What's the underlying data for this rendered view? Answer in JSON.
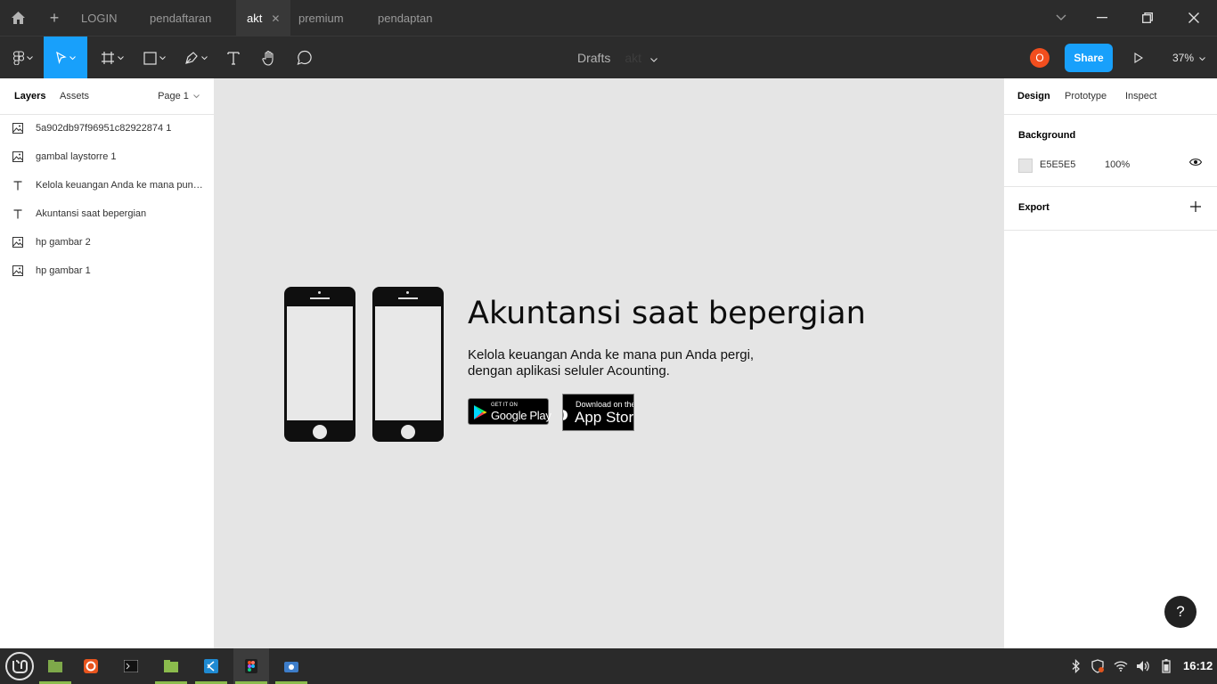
{
  "tabbar": {
    "tabs": [
      {
        "label": "LOGIN",
        "active": false
      },
      {
        "label": "pendaftaran",
        "active": false
      },
      {
        "label": "akt",
        "active": true
      },
      {
        "label": "premium",
        "active": false
      },
      {
        "label": "pendaptan",
        "active": false
      }
    ]
  },
  "toolbar": {
    "drafts": "Drafts",
    "file_name": "akt",
    "avatar_initial": "O",
    "share_label": "Share",
    "zoom": "37%"
  },
  "left_panel": {
    "tabs": [
      "Layers",
      "Assets"
    ],
    "page": "Page 1",
    "layers": [
      {
        "name": "5a902db97f96951c82922874 1",
        "icon": "image-icon"
      },
      {
        "name": "gambal laystorre 1",
        "icon": "image-icon"
      },
      {
        "name": "Kelola keuangan Anda ke mana pun Anda pergi, dengan aplikasi seluler Acounting.",
        "icon": "text-icon"
      },
      {
        "name": "Akuntansi saat bepergian",
        "icon": "text-icon"
      },
      {
        "name": "hp gambar 2",
        "icon": "image-icon"
      },
      {
        "name": "hp gambar 1",
        "icon": "image-icon"
      }
    ]
  },
  "canvas": {
    "headline": "Akuntansi saat bepergian",
    "subtext_line1": "Kelola keuangan Anda ke mana pun Anda pergi,",
    "subtext_line2": "dengan aplikasi seluler Acounting.",
    "google_play_small": "GET IT ON",
    "google_play_big": "Google Play",
    "app_store_small": "Download on the",
    "app_store_big": "App Store"
  },
  "right_panel": {
    "tabs": [
      "Design",
      "Prototype",
      "Inspect"
    ],
    "background_heading": "Background",
    "background_hex": "E5E5E5",
    "background_opacity": "100%",
    "export_heading": "Export",
    "help": "?"
  },
  "taskbar": {
    "clock": "16:12"
  },
  "colors": {
    "accent": "#18a0fb",
    "avatar": "#f24e1e",
    "canvas_bg": "#e5e5e5",
    "chrome_bg": "#2c2c2c"
  }
}
